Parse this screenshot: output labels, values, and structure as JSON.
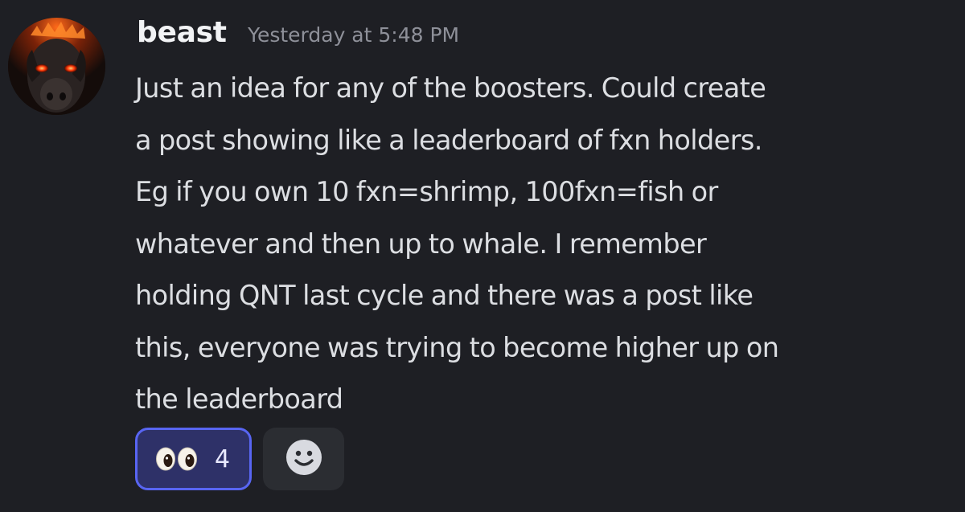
{
  "message": {
    "author": "beast",
    "timestamp": "Yesterday at 5:48 PM",
    "lines": [
      "Just an idea for any of the boosters. Could create",
      "a post showing like a leaderboard of fxn holders.",
      "Eg if you own 10 fxn=shrimp, 100fxn=fish or",
      "whatever and then up to whale. I remember",
      "holding QNT last cycle and there was a post like",
      "this, everyone was trying to become higher up on",
      "the leaderboard"
    ]
  },
  "reactions": [
    {
      "emoji": "eyes-icon",
      "count": "4",
      "selected": true
    }
  ],
  "add_reaction": {
    "icon": "smiley-face-icon"
  },
  "colors": {
    "background": "#1e1f24",
    "accent": "#5865f2",
    "text": "#dcdee2",
    "muted": "#8e9099"
  }
}
